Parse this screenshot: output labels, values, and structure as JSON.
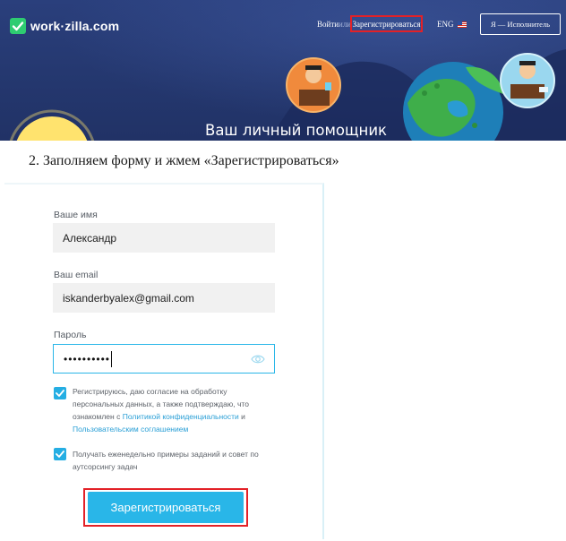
{
  "header": {
    "logo_text": "work·zilla.com",
    "login_link": "Войти",
    "or_text": "или",
    "register_link": "Зарегистрироваться",
    "language": "ENG",
    "role_button": "Я — Исполнитель",
    "banner_title": "Ваш личный помощник"
  },
  "step_heading": "2. Заполняем форму и жмем «Зарегистрироваться»",
  "form": {
    "name_label": "Ваше имя",
    "name_value": "Александр",
    "email_label": "Ваш email",
    "email_value": "iskanderbyalex@gmail.com",
    "password_label": "Пароль",
    "password_value": "••••••••••",
    "consent_text_1": "Регистрируюсь, даю согласие на обработку персональных данных, а также подтверждаю, что ознакомлен с",
    "consent_link_1": "Политикой конфиденциальности",
    "consent_and": "и",
    "consent_link_2": "Пользовательским соглашением",
    "newsletter_text": "Получать еженедельно примеры заданий и совет по аутсорсингу задач",
    "consent_checked": true,
    "newsletter_checked": true,
    "submit_label": "Зарегистрироваться"
  },
  "colors": {
    "accent": "#29b6e8",
    "highlight_frame": "#e32127",
    "banner_bg": "#24376e",
    "logo_green": "#2ecc71"
  },
  "icons": [
    "check-logo-icon",
    "us-flag-icon",
    "eye-icon",
    "checkbox-check-icon"
  ]
}
